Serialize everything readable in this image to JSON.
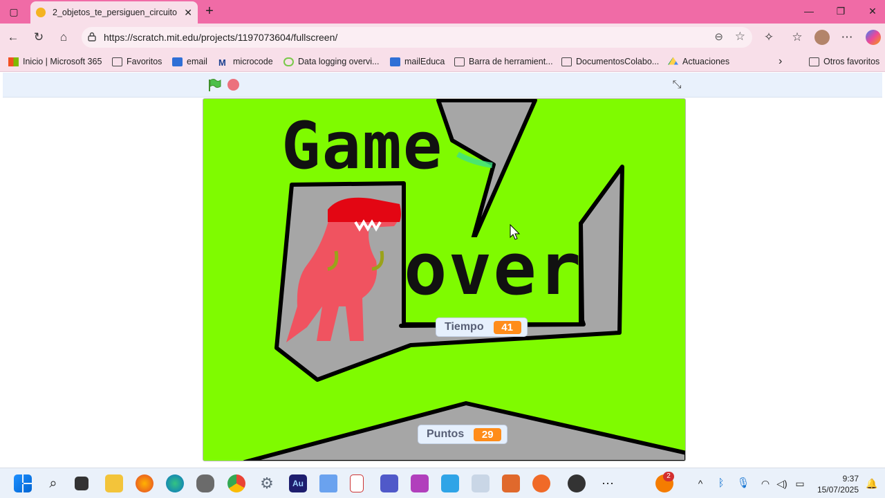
{
  "browser": {
    "tab_title": "2_objetos_te_persiguen_circuito o",
    "url": "https://scratch.mit.edu/projects/1197073604/fullscreen/",
    "bookmarks": [
      "Inicio | Microsoft 365",
      "Favoritos",
      "email",
      "microcode",
      "Data logging overvi...",
      "mailEduca",
      "Barra de herramient...",
      "DocumentosColabo...",
      "Actuaciones"
    ],
    "other_favorites": "Otros favoritos",
    "theme_color": "#f06ba6"
  },
  "stage": {
    "title_word_1": "Game",
    "title_word_2": "over",
    "background_color": "#7ffb00",
    "monitors": {
      "tiempo_label": "Tiempo",
      "tiempo_value": "41",
      "puntos_label": "Puntos",
      "puntos_value": "29"
    }
  },
  "taskbar": {
    "notification_count": "2",
    "time": "9:37",
    "date": "15/07/2025"
  }
}
